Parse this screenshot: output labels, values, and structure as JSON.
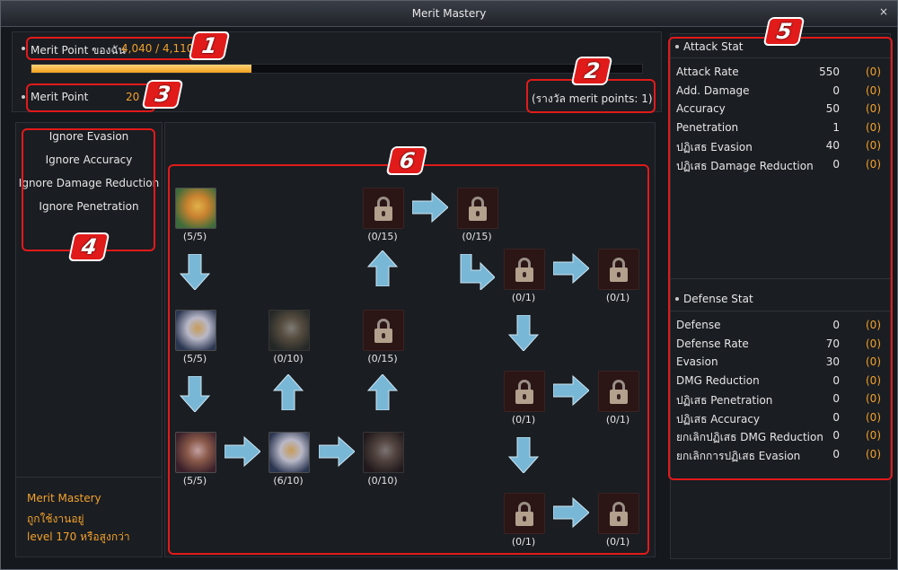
{
  "window": {
    "title": "Merit Mastery",
    "close_glyph": "×"
  },
  "merit": {
    "label": "Merit Point ของฉัน",
    "value": "4,040 / 4,110",
    "progress": 0.36,
    "point_label": "Merit Point",
    "point_value": "20",
    "reward": "(รางวัล merit points: 1)"
  },
  "ignore_list": [
    "Ignore Evasion",
    "Ignore Accuracy",
    "Ignore Damage Reduction",
    "Ignore Penetration"
  ],
  "footer": {
    "title": "Merit Mastery",
    "status": "ถูกใช้งานอยู่",
    "requirement": "level 170 หรือสูงกว่า"
  },
  "attack": {
    "title": "Attack Stat",
    "rows": [
      {
        "name": "Attack Rate",
        "value": "550",
        "bonus": "(0)"
      },
      {
        "name": "Add. Damage",
        "value": "0",
        "bonus": "(0)"
      },
      {
        "name": "Accuracy",
        "value": "50",
        "bonus": "(0)"
      },
      {
        "name": "Penetration",
        "value": "1",
        "bonus": "(0)"
      },
      {
        "name": "ปฏิเสธ Evasion",
        "value": "40",
        "bonus": "(0)"
      },
      {
        "name": "ปฏิเสธ Damage Reduction",
        "value": "0",
        "bonus": "(0)"
      }
    ]
  },
  "defense": {
    "title": "Defense Stat",
    "rows": [
      {
        "name": "Defense",
        "value": "0",
        "bonus": "(0)"
      },
      {
        "name": "Defense Rate",
        "value": "70",
        "bonus": "(0)"
      },
      {
        "name": "Evasion",
        "value": "30",
        "bonus": "(0)"
      },
      {
        "name": "DMG Reduction",
        "value": "0",
        "bonus": "(0)"
      },
      {
        "name": "ปฏิเสธ Penetration",
        "value": "0",
        "bonus": "(0)"
      },
      {
        "name": "ปฏิเสธ Accuracy",
        "value": "0",
        "bonus": "(0)"
      },
      {
        "name": "ยกเลิกปฏิเสธ DMG Reduction",
        "value": "0",
        "bonus": "(0)"
      },
      {
        "name": "ยกเลิกการปฏิเสธ Evasion",
        "value": "0",
        "bonus": "(0)"
      }
    ]
  },
  "tree": {
    "skills": [
      {
        "id": "s1",
        "icon": "sword-shield-icon",
        "count": "(5/5)",
        "locked": false
      },
      {
        "id": "s2",
        "icon": "hammer-icon",
        "count": "(5/5)",
        "locked": false
      },
      {
        "id": "s3",
        "icon": "crossed-axes-icon",
        "count": "(5/5)",
        "locked": false
      },
      {
        "id": "s4",
        "icon": "shield-sword-icon",
        "count": "(0/10)",
        "locked": false
      },
      {
        "id": "s5",
        "icon": "hammer-icon",
        "count": "(6/10)",
        "locked": false
      },
      {
        "id": "s6",
        "icon": "crossed-axes-icon",
        "count": "(0/10)",
        "locked": false
      },
      {
        "id": "l1",
        "icon": "lock-icon",
        "count": "(0/15)",
        "locked": true
      },
      {
        "id": "l2",
        "icon": "lock-icon",
        "count": "(0/15)",
        "locked": true
      },
      {
        "id": "l3",
        "icon": "lock-icon",
        "count": "(0/15)",
        "locked": true
      },
      {
        "id": "l4",
        "icon": "lock-icon",
        "count": "(0/1)",
        "locked": true
      },
      {
        "id": "l5",
        "icon": "lock-icon",
        "count": "(0/1)",
        "locked": true
      },
      {
        "id": "l6",
        "icon": "lock-icon",
        "count": "(0/1)",
        "locked": true
      },
      {
        "id": "l7",
        "icon": "lock-icon",
        "count": "(0/1)",
        "locked": true
      },
      {
        "id": "l8",
        "icon": "lock-icon",
        "count": "(0/1)",
        "locked": true
      },
      {
        "id": "l9",
        "icon": "lock-icon",
        "count": "(0/1)",
        "locked": true
      }
    ]
  },
  "callouts": [
    "1",
    "2",
    "3",
    "4",
    "5",
    "6"
  ],
  "colors": {
    "accent": "#f3a22a",
    "highlight": "#e11a1a",
    "arrow": "#79b7d6"
  }
}
